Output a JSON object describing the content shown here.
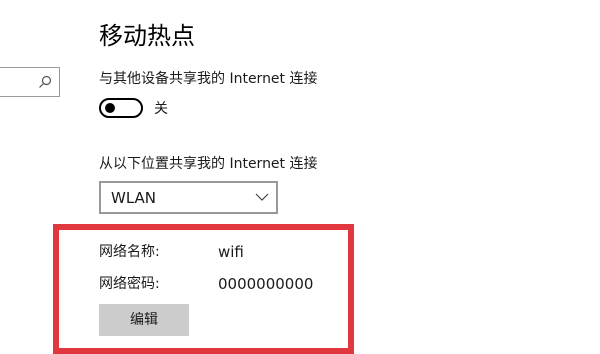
{
  "page": {
    "title": "移动热点"
  },
  "search": {
    "icon": "search-icon"
  },
  "share_connection": {
    "label": "与其他设备共享我的 Internet 连接",
    "toggle_state_label": "关",
    "toggle_on": false
  },
  "share_from": {
    "label": "从以下位置共享我的 Internet 连接",
    "selected_value": "WLAN",
    "icon": "chevron-down-icon"
  },
  "network": {
    "name_label": "网络名称:",
    "name_value": "wifi",
    "password_label": "网络密码:",
    "password_value": "0000000000",
    "edit_button_label": "编辑"
  },
  "colors": {
    "highlight_border": "#e0383e",
    "edit_button_bg": "#cccccc"
  }
}
